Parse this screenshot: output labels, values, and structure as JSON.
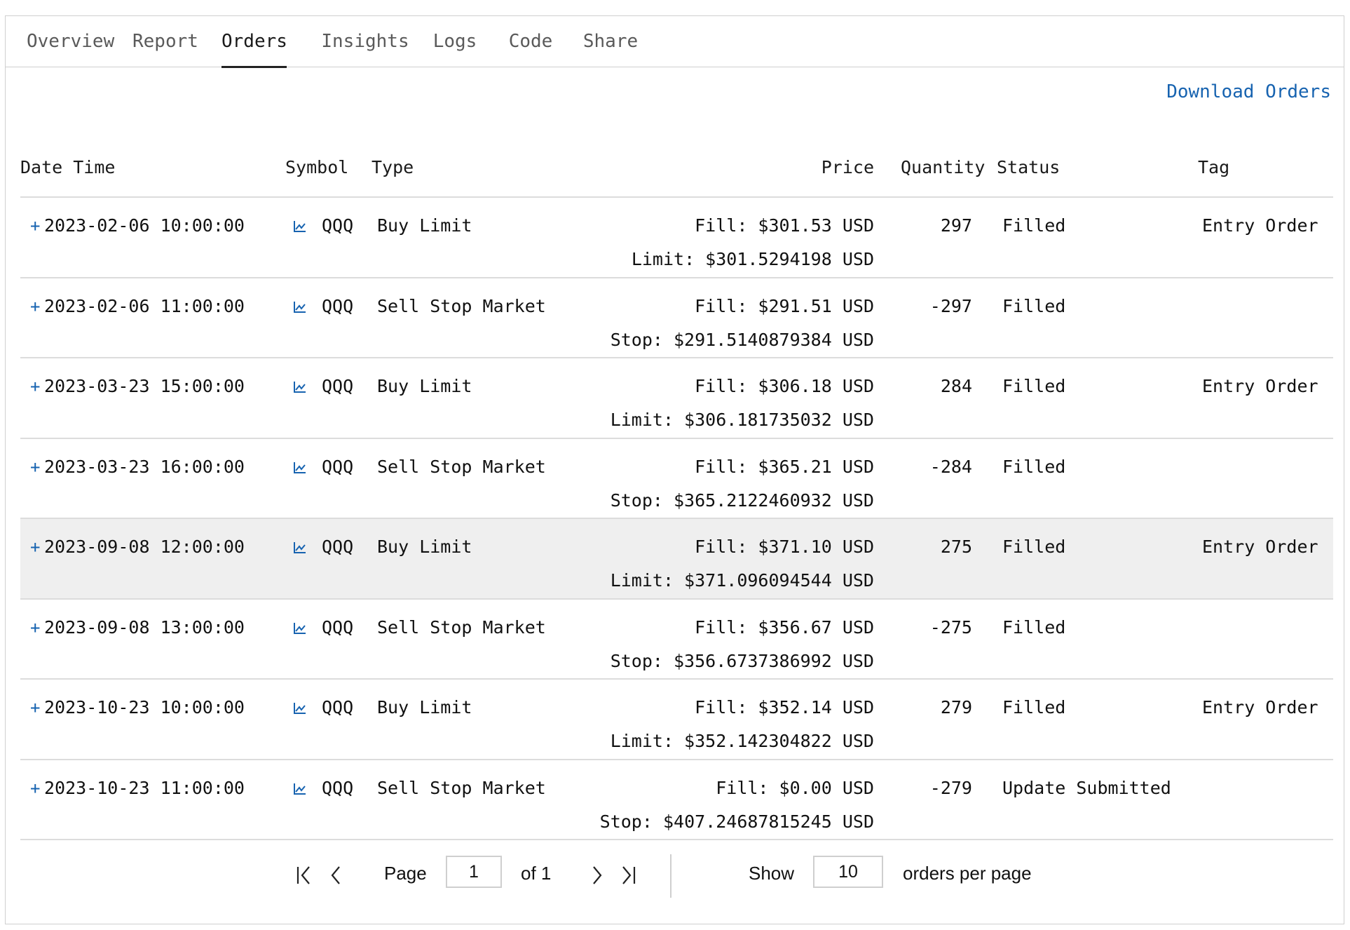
{
  "tabs": [
    "Overview",
    "Report",
    "Orders",
    "Insights",
    "Logs",
    "Code",
    "Share"
  ],
  "active_tab": "Orders",
  "download_label": "Download Orders",
  "columns": {
    "datetime": "Date Time",
    "symbol": "Symbol",
    "type": "Type",
    "price": "Price",
    "quantity": "Quantity",
    "status": "Status",
    "tag": "Tag"
  },
  "orders": [
    {
      "expand": "+",
      "datetime": "2023-02-06 10:00:00",
      "symbol": "QQQ",
      "type": "Buy Limit",
      "fill": "Fill: $301.53 USD",
      "sub_price": "Limit: $301.5294198 USD",
      "quantity": "297",
      "status": "Filled",
      "tag": "Entry Order"
    },
    {
      "expand": "+",
      "datetime": "2023-02-06 11:00:00",
      "symbol": "QQQ",
      "type": "Sell Stop Market",
      "fill": "Fill: $291.51 USD",
      "sub_price": "Stop: $291.5140879384 USD",
      "quantity": "-297",
      "status": "Filled",
      "tag": ""
    },
    {
      "expand": "+",
      "datetime": "2023-03-23 15:00:00",
      "symbol": "QQQ",
      "type": "Buy Limit",
      "fill": "Fill: $306.18 USD",
      "sub_price": "Limit: $306.181735032 USD",
      "quantity": "284",
      "status": "Filled",
      "tag": "Entry Order"
    },
    {
      "expand": "+",
      "datetime": "2023-03-23 16:00:00",
      "symbol": "QQQ",
      "type": "Sell Stop Market",
      "fill": "Fill: $365.21 USD",
      "sub_price": "Stop: $365.2122460932 USD",
      "quantity": "-284",
      "status": "Filled",
      "tag": ""
    },
    {
      "expand": "+",
      "datetime": "2023-09-08 12:00:00",
      "symbol": "QQQ",
      "type": "Buy Limit",
      "fill": "Fill: $371.10 USD",
      "sub_price": "Limit: $371.096094544 USD",
      "quantity": "275",
      "status": "Filled",
      "tag": "Entry Order"
    },
    {
      "expand": "+",
      "datetime": "2023-09-08 13:00:00",
      "symbol": "QQQ",
      "type": "Sell Stop Market",
      "fill": "Fill: $356.67 USD",
      "sub_price": "Stop: $356.6737386992 USD",
      "quantity": "-275",
      "status": "Filled",
      "tag": ""
    },
    {
      "expand": "+",
      "datetime": "2023-10-23 10:00:00",
      "symbol": "QQQ",
      "type": "Buy Limit",
      "fill": "Fill: $352.14 USD",
      "sub_price": "Limit: $352.142304822 USD",
      "quantity": "279",
      "status": "Filled",
      "tag": "Entry Order"
    },
    {
      "expand": "+",
      "datetime": "2023-10-23 11:00:00",
      "symbol": "QQQ",
      "type": "Sell Stop Market",
      "fill": "Fill: $0.00 USD",
      "sub_price": "Stop: $407.24687815245 USD",
      "quantity": "-279",
      "status": "Update Submitted",
      "tag": ""
    }
  ],
  "pagination": {
    "page_label": "Page",
    "page_value": "1",
    "of_label": "of 1",
    "show_label": "Show",
    "per_page_value": "10",
    "per_page_suffix": "orders per page"
  },
  "colors": {
    "link": "#1763b0",
    "border": "#cfcfcf",
    "row_highlight": "#efefef"
  }
}
